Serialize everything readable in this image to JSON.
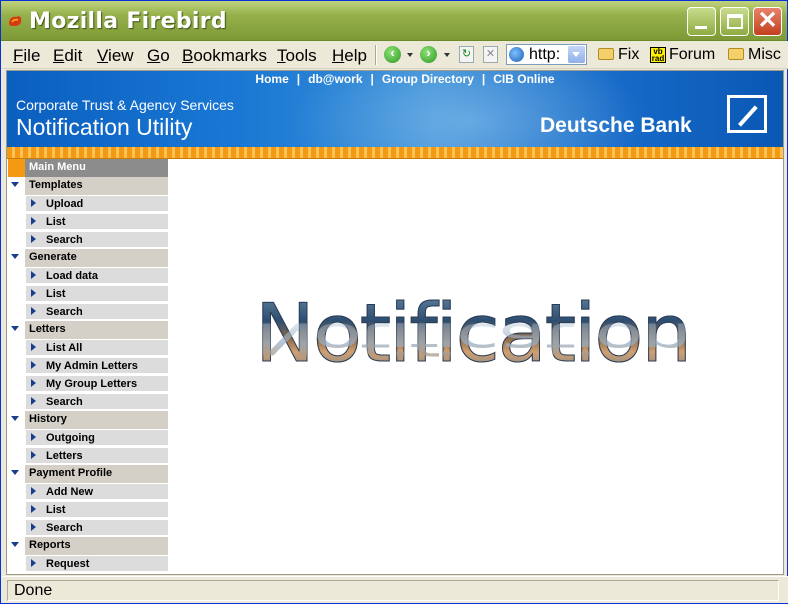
{
  "window": {
    "title": "Mozilla Firebird"
  },
  "menubar": {
    "menus": [
      {
        "label": "File",
        "ul": "F",
        "rest": "ile"
      },
      {
        "label": "Edit",
        "ul": "E",
        "rest": "dit"
      },
      {
        "label": "View",
        "ul": "V",
        "rest": "iew"
      },
      {
        "label": "Go",
        "ul": "G",
        "rest": "o"
      },
      {
        "label": "Bookmarks",
        "ul": "B",
        "rest": "ookmarks"
      },
      {
        "label": "Tools",
        "ul": "T",
        "rest": "ools"
      },
      {
        "label": "Help",
        "ul": "H",
        "rest": "elp"
      }
    ],
    "url_value": "http:",
    "bookmarks": [
      "Fix",
      "Forum",
      "Misc"
    ],
    "forum_icon_text": "vb rad"
  },
  "banner": {
    "links": [
      "Home",
      "db@work",
      "Group Directory",
      "CIB Online"
    ],
    "separator": "|",
    "subtitle": "Corporate Trust & Agency Services",
    "title": "Notification Utility",
    "bank_name": "Deutsche Bank"
  },
  "sidebar": {
    "main_menu": "Main Menu",
    "sections": [
      {
        "label": "Templates",
        "items": [
          "Upload",
          "List",
          "Search"
        ]
      },
      {
        "label": "Generate",
        "items": [
          "Load data",
          "List",
          "Search"
        ]
      },
      {
        "label": "Letters",
        "items": [
          "List All",
          "My Admin Letters",
          "My Group Letters",
          "Search"
        ]
      },
      {
        "label": "History",
        "items": [
          "Outgoing",
          "Letters"
        ]
      },
      {
        "label": "Payment Profile",
        "items": [
          "Add New",
          "List",
          "Search"
        ]
      },
      {
        "label": "Reports",
        "items": [
          "Request"
        ]
      }
    ]
  },
  "main": {
    "logo_text": "Notification"
  },
  "status": {
    "text": "Done"
  }
}
